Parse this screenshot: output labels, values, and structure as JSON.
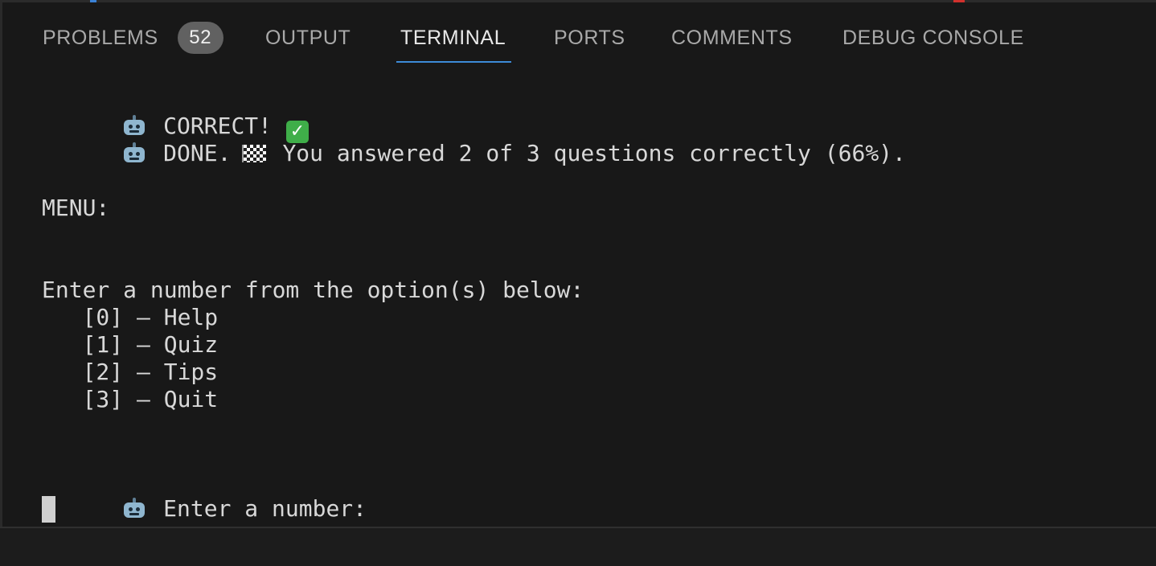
{
  "tabs": [
    {
      "label": "PROBLEMS",
      "badge": "52",
      "active": false
    },
    {
      "label": "OUTPUT",
      "active": false
    },
    {
      "label": "TERMINAL",
      "active": true
    },
    {
      "label": "PORTS",
      "active": false
    },
    {
      "label": "COMMENTS",
      "active": false
    },
    {
      "label": "DEBUG CONSOLE",
      "active": false
    }
  ],
  "terminal": {
    "correct_text": "CORRECT!",
    "done_prefix": "DONE.",
    "done_text": "You answered 2 of 3 questions correctly (66%).",
    "menu_title": "MENU:",
    "prompt_intro": "Enter a number from the option(s) below:",
    "options": [
      "   [0] – Help",
      "   [1] – Quiz",
      "   [2] – Tips",
      "   [3] – Quit"
    ],
    "input_prompt": "Enter a number:",
    "icons": {
      "robot": "robot-face-icon",
      "check": "check-mark-icon",
      "flag": "chequered-flag-icon"
    }
  },
  "colors": {
    "background": "#181818",
    "accent": "#3d8bd8",
    "badge": "#616161",
    "text": "#d8d8d8"
  }
}
